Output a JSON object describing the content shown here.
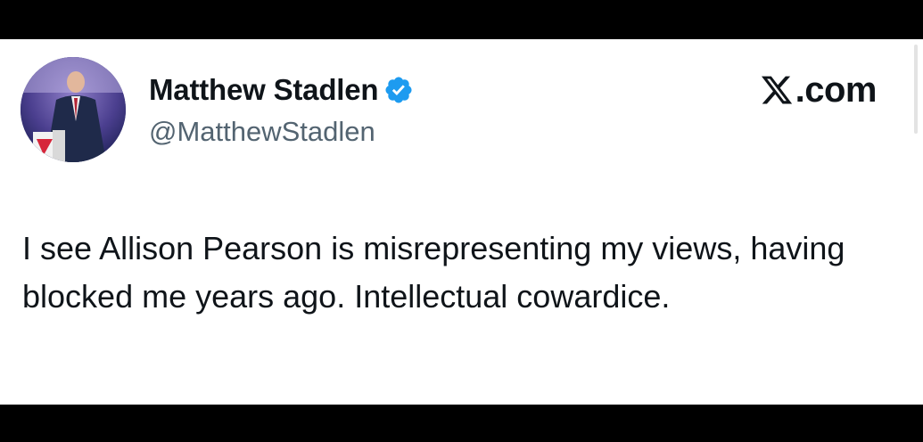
{
  "tweet": {
    "author": {
      "display_name": "Matthew Stadlen",
      "handle": "@MatthewStadlen",
      "verified": true,
      "avatar_icon": "profile-photo"
    },
    "source_logo_icon": "x-logo",
    "source_label": ".com",
    "text": "I see Allison Pearson is misrepresenting my views, having blocked me years ago. Intellectual cowardice."
  },
  "colors": {
    "background_bars": "#000000",
    "card": "#ffffff",
    "text_primary": "#0f1419",
    "text_secondary": "#536471",
    "verified_badge": "#1d9bf0"
  }
}
